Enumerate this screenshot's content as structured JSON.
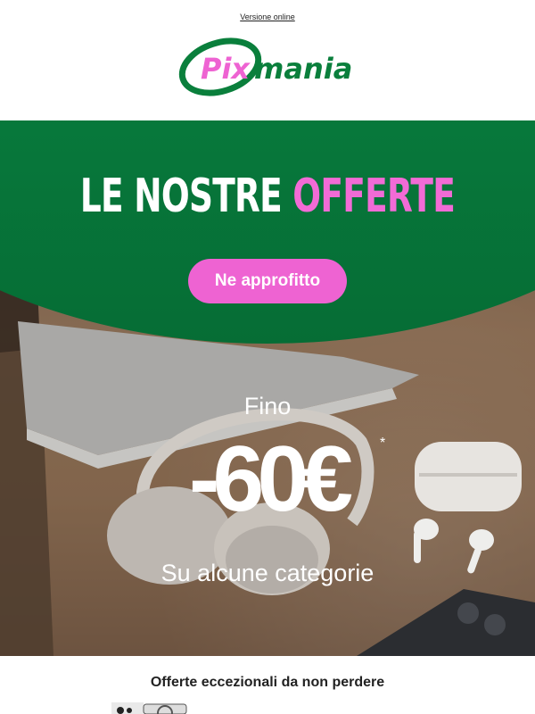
{
  "header": {
    "online_link": "Versione online",
    "logo_text": "Pixmania",
    "logo_part1": "Pix",
    "logo_part2": "mania"
  },
  "hero": {
    "headline_part1": "LE NOSTRE ",
    "headline_part2": "OFFERTE",
    "cta_label": "Ne approfitto",
    "fino": "Fino",
    "amount": "-60€",
    "asterisk": "*",
    "categories": "Su alcune categorie"
  },
  "section": {
    "title": "Offerte eccezionali da non perdere"
  },
  "colors": {
    "brand_green": "#0a8f48",
    "brand_pink": "#ee63d2",
    "text_dark": "#222222"
  }
}
